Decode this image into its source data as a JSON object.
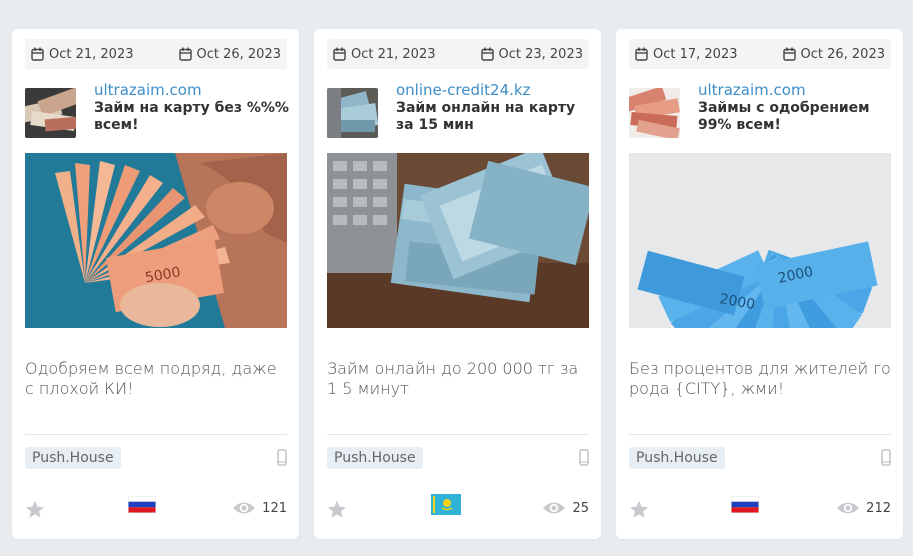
{
  "colors": {
    "page_bg": "#e9ecef",
    "link": "#3d8ec9",
    "badge_bg": "#e7eef4",
    "icon_gray": "#c7c9cc"
  },
  "cards": [
    {
      "start_date": "Oct 21, 2023",
      "end_date": "Oct 26, 2023",
      "domain": "ultrazaim.com",
      "title": "Займ на карту без %%%  всем!",
      "description": "Одобряем всем подряд, даже с плохой КИ!",
      "network": "Push.House",
      "device_icon": "mobile-phone-icon",
      "flag_icon": "russia-flag-icon",
      "views": "121"
    },
    {
      "start_date": "Oct 21, 2023",
      "end_date": "Oct 23, 2023",
      "domain": "online-credit24.kz",
      "title": "Займ онлайн на карту за 15 мин",
      "description": "Займ онлайн до 200 000 тг за 1 5 минут",
      "network": "Push.House",
      "device_icon": "mobile-phone-icon",
      "flag_icon": "kazakhstan-flag-icon",
      "views": "25"
    },
    {
      "start_date": "Oct 17, 2023",
      "end_date": "Oct 26, 2023",
      "domain": "ultrazaim.com",
      "title": "Займы с одобрением 99% всем!",
      "description": "Без процентов для жителей го рода {CITY}, жми!",
      "network": "Push.House",
      "device_icon": "mobile-phone-icon",
      "flag_icon": "russia-flag-icon",
      "views": "212"
    }
  ]
}
